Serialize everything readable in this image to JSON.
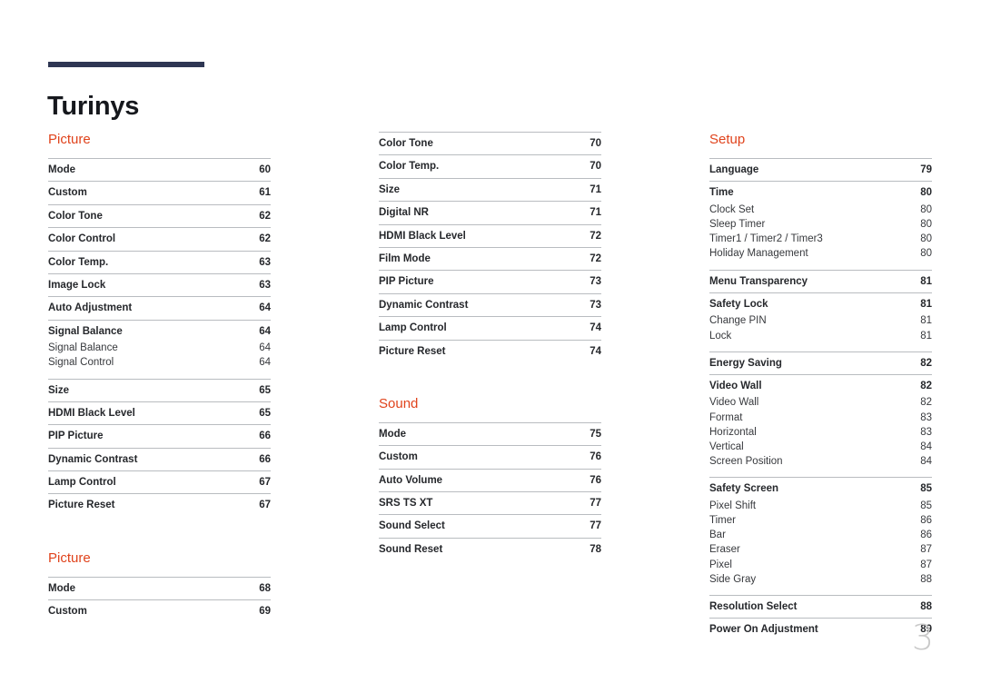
{
  "document": {
    "title": "Turinys",
    "page_number": "3"
  },
  "colors": {
    "title_rule": "#2e3653",
    "section_heading": "#e0431c",
    "entry_text": "#26282c",
    "sub_entry_text": "#37393d",
    "rule": "#b9bcc0",
    "page_number": "#c9c9c9"
  },
  "columns": [
    {
      "sections": [
        {
          "heading": "Picture",
          "groups": [
            {
              "main": {
                "label": "Mode",
                "page": "60"
              },
              "subs": []
            },
            {
              "main": {
                "label": "Custom",
                "page": "61"
              },
              "subs": []
            },
            {
              "main": {
                "label": "Color Tone",
                "page": "62"
              },
              "subs": []
            },
            {
              "main": {
                "label": "Color Control",
                "page": "62"
              },
              "subs": []
            },
            {
              "main": {
                "label": "Color Temp.",
                "page": "63"
              },
              "subs": []
            },
            {
              "main": {
                "label": "Image Lock",
                "page": "63"
              },
              "subs": []
            },
            {
              "main": {
                "label": "Auto Adjustment",
                "page": "64"
              },
              "subs": []
            },
            {
              "main": {
                "label": "Signal Balance",
                "page": "64"
              },
              "subs": [
                {
                  "label": "Signal Balance",
                  "page": "64"
                },
                {
                  "label": "Signal Control",
                  "page": "64"
                }
              ]
            },
            {
              "main": {
                "label": "Size",
                "page": "65"
              },
              "subs": []
            },
            {
              "main": {
                "label": "HDMI Black Level",
                "page": "65"
              },
              "subs": []
            },
            {
              "main": {
                "label": "PIP Picture",
                "page": "66"
              },
              "subs": []
            },
            {
              "main": {
                "label": "Dynamic Contrast",
                "page": "66"
              },
              "subs": []
            },
            {
              "main": {
                "label": "Lamp Control",
                "page": "67"
              },
              "subs": []
            },
            {
              "main": {
                "label": "Picture Reset",
                "page": "67"
              },
              "subs": []
            }
          ]
        },
        {
          "heading": "Picture",
          "groups": [
            {
              "main": {
                "label": "Mode",
                "page": "68"
              },
              "subs": []
            },
            {
              "main": {
                "label": "Custom",
                "page": "69"
              },
              "subs": []
            }
          ]
        }
      ]
    },
    {
      "sections": [
        {
          "heading": "",
          "groups": [
            {
              "main": {
                "label": "Color Tone",
                "page": "70"
              },
              "subs": []
            },
            {
              "main": {
                "label": "Color Temp.",
                "page": "70"
              },
              "subs": []
            },
            {
              "main": {
                "label": "Size",
                "page": "71"
              },
              "subs": []
            },
            {
              "main": {
                "label": "Digital NR",
                "page": "71"
              },
              "subs": []
            },
            {
              "main": {
                "label": "HDMI Black Level",
                "page": "72"
              },
              "subs": []
            },
            {
              "main": {
                "label": "Film Mode",
                "page": "72"
              },
              "subs": []
            },
            {
              "main": {
                "label": "PIP Picture",
                "page": "73"
              },
              "subs": []
            },
            {
              "main": {
                "label": "Dynamic Contrast",
                "page": "73"
              },
              "subs": []
            },
            {
              "main": {
                "label": "Lamp Control",
                "page": "74"
              },
              "subs": []
            },
            {
              "main": {
                "label": "Picture Reset",
                "page": "74"
              },
              "subs": []
            }
          ]
        },
        {
          "heading": "Sound",
          "groups": [
            {
              "main": {
                "label": "Mode",
                "page": "75"
              },
              "subs": []
            },
            {
              "main": {
                "label": "Custom",
                "page": "76"
              },
              "subs": []
            },
            {
              "main": {
                "label": "Auto Volume",
                "page": "76"
              },
              "subs": []
            },
            {
              "main": {
                "label": "SRS TS XT",
                "page": "77"
              },
              "subs": []
            },
            {
              "main": {
                "label": "Sound Select",
                "page": "77"
              },
              "subs": []
            },
            {
              "main": {
                "label": "Sound Reset",
                "page": "78"
              },
              "subs": []
            }
          ]
        }
      ]
    },
    {
      "sections": [
        {
          "heading": "Setup",
          "groups": [
            {
              "main": {
                "label": "Language",
                "page": "79"
              },
              "subs": []
            },
            {
              "main": {
                "label": "Time",
                "page": "80"
              },
              "subs": [
                {
                  "label": "Clock Set",
                  "page": "80"
                },
                {
                  "label": "Sleep Timer",
                  "page": "80"
                },
                {
                  "label": "Timer1 / Timer2 / Timer3",
                  "page": "80"
                },
                {
                  "label": "Holiday Management",
                  "page": "80"
                }
              ]
            },
            {
              "main": {
                "label": "Menu Transparency",
                "page": "81"
              },
              "subs": []
            },
            {
              "main": {
                "label": "Safety Lock",
                "page": "81"
              },
              "subs": [
                {
                  "label": "Change PIN",
                  "page": "81"
                },
                {
                  "label": "Lock",
                  "page": "81"
                }
              ]
            },
            {
              "main": {
                "label": "Energy Saving",
                "page": "82"
              },
              "subs": []
            },
            {
              "main": {
                "label": "Video Wall",
                "page": "82"
              },
              "subs": [
                {
                  "label": "Video Wall",
                  "page": "82"
                },
                {
                  "label": "Format",
                  "page": "83"
                },
                {
                  "label": "Horizontal",
                  "page": "83"
                },
                {
                  "label": "Vertical",
                  "page": "84"
                },
                {
                  "label": "Screen Position",
                  "page": "84"
                }
              ]
            },
            {
              "main": {
                "label": "Safety Screen",
                "page": "85"
              },
              "subs": [
                {
                  "label": "Pixel Shift",
                  "page": "85"
                },
                {
                  "label": "Timer",
                  "page": "86"
                },
                {
                  "label": "Bar",
                  "page": "86"
                },
                {
                  "label": "Eraser",
                  "page": "87"
                },
                {
                  "label": "Pixel",
                  "page": "87"
                },
                {
                  "label": "Side Gray",
                  "page": "88"
                }
              ]
            },
            {
              "main": {
                "label": "Resolution Select",
                "page": "88"
              },
              "subs": []
            },
            {
              "main": {
                "label": "Power On Adjustment",
                "page": "89"
              },
              "subs": []
            }
          ]
        }
      ]
    }
  ]
}
